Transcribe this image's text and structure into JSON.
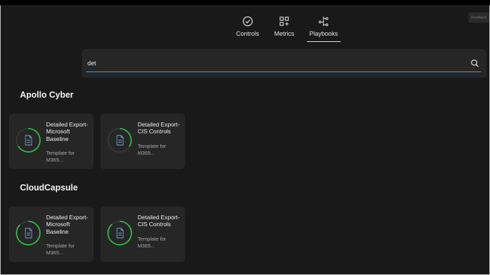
{
  "window": {
    "corner_button_label": "Feedback"
  },
  "nav": {
    "items": [
      {
        "label": "Controls",
        "icon": "check-circle-icon"
      },
      {
        "label": "Metrics",
        "icon": "grid-plus-icon"
      },
      {
        "label": "Playbooks",
        "icon": "branch-icon",
        "active": true
      }
    ]
  },
  "search": {
    "value": "det",
    "placeholder": ""
  },
  "groups": [
    {
      "title": "Apollo Cyber",
      "cards": [
        {
          "title": "Detailed Export-Microsoft Baseline",
          "desc": "Template for M365..."
        },
        {
          "title": "Detailed Export-CIS Controls",
          "desc": "Template for M365..."
        }
      ]
    },
    {
      "title": "CloudCapsule",
      "cards": [
        {
          "title": "Detailed Export-Microsoft Baseline",
          "desc": "Template for M365..."
        },
        {
          "title": "Detailed Export-CIS Controls",
          "desc": "Template for M365..."
        }
      ]
    }
  ],
  "colors": {
    "background": "#191919",
    "card": "#262626",
    "accent_green": "#2ec84a",
    "accent_blue": "#3aa0e6"
  }
}
